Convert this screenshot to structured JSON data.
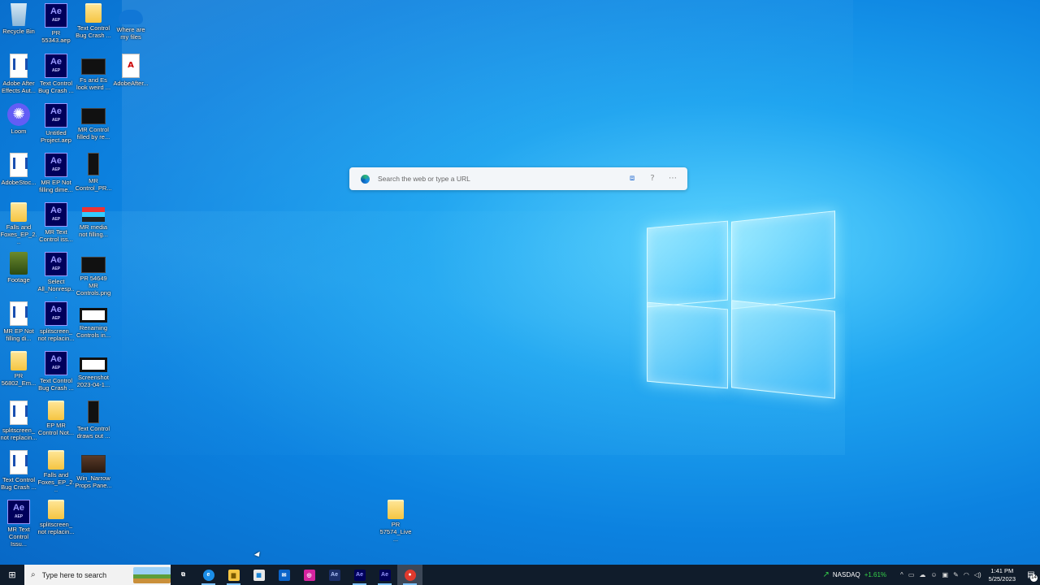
{
  "desktop": {
    "icons": [
      {
        "label": "Recycle Bin",
        "kind": "bin"
      },
      {
        "label": "PR 55343.aep",
        "kind": "ae"
      },
      {
        "label": "Text Control Bug Crash ...",
        "kind": "folder"
      },
      {
        "label": "Where are my files",
        "kind": "cloud"
      },
      {
        "label": "Adobe After Effects Aut...",
        "kind": "doc"
      },
      {
        "label": "Text Control Bug Crash ...",
        "kind": "ae"
      },
      {
        "label": "Fs and Es look weird ...",
        "kind": "img"
      },
      {
        "label": "AdobeAfter...",
        "kind": "pdf"
      },
      {
        "label": "Loom",
        "kind": "loom"
      },
      {
        "label": "Untitled Project.aep",
        "kind": "ae"
      },
      {
        "label": "MR Control filled by re...",
        "kind": "img"
      },
      {
        "label": "AdobeStoc...",
        "kind": "doc"
      },
      {
        "label": "MR EP Not filling dime...",
        "kind": "ae"
      },
      {
        "label": "MR Control_PR...",
        "kind": "phone"
      },
      {
        "label": "Falls and Foxes_EP_2...",
        "kind": "folder"
      },
      {
        "label": "MR Text Control iss...",
        "kind": "ae"
      },
      {
        "label": "MR media not filling...",
        "kind": "media"
      },
      {
        "label": "Footage",
        "kind": "green"
      },
      {
        "label": "Select All_Nonresp...",
        "kind": "ae"
      },
      {
        "label": "PR 54649 MR Controls.png",
        "kind": "img"
      },
      {
        "label": "MR EP Not filling di...",
        "kind": "doc"
      },
      {
        "label": "splitscreen_ not replacin...",
        "kind": "ae"
      },
      {
        "label": "Renaming Controls in...",
        "kind": "imgw"
      },
      {
        "label": "PR 56802_Em...",
        "kind": "folder"
      },
      {
        "label": "Text Control Bug Crash ...",
        "kind": "ae"
      },
      {
        "label": "Screenshot 2023-04-1...",
        "kind": "imgw"
      },
      {
        "label": "splitscreen_ not replacin...",
        "kind": "doc"
      },
      {
        "label": "EP MR Control Not...",
        "kind": "folder"
      },
      {
        "label": "Text Control draws out ...",
        "kind": "phone"
      },
      {
        "label": "Text Control Bug Crash ...",
        "kind": "doc"
      },
      {
        "label": "Falls and Foxes_EP_2...",
        "kind": "folder"
      },
      {
        "label": "Win_Narrow Props Pane...",
        "kind": "still"
      },
      {
        "label": "MR Text Control Issu...",
        "kind": "ae"
      },
      {
        "label": "splitscreen_ not replacin...",
        "kind": "folder"
      },
      {
        "label": "PR 57574_Live ...",
        "kind": "folder"
      }
    ]
  },
  "search_box": {
    "placeholder": "Search the web or type a URL"
  },
  "taskbar": {
    "search_placeholder": "Type here to search",
    "apps": [
      {
        "name": "task-view",
        "glyph": "⧉"
      },
      {
        "name": "edge",
        "glyph": "e"
      },
      {
        "name": "file-explorer",
        "glyph": "▆"
      },
      {
        "name": "store",
        "glyph": "▦"
      },
      {
        "name": "mail",
        "glyph": "✉"
      },
      {
        "name": "instagram",
        "glyph": "◎"
      },
      {
        "name": "media-encoder",
        "glyph": "Ae"
      },
      {
        "name": "after-effects-1",
        "glyph": "Ae"
      },
      {
        "name": "after-effects-2",
        "glyph": "Ae"
      },
      {
        "name": "recorder",
        "glyph": "●"
      }
    ],
    "stock": {
      "ticker": "NASDAQ",
      "change": "+1.61%"
    },
    "clock": {
      "time": "1:41 PM",
      "date": "5/25/2023"
    },
    "notification_count": "14"
  }
}
